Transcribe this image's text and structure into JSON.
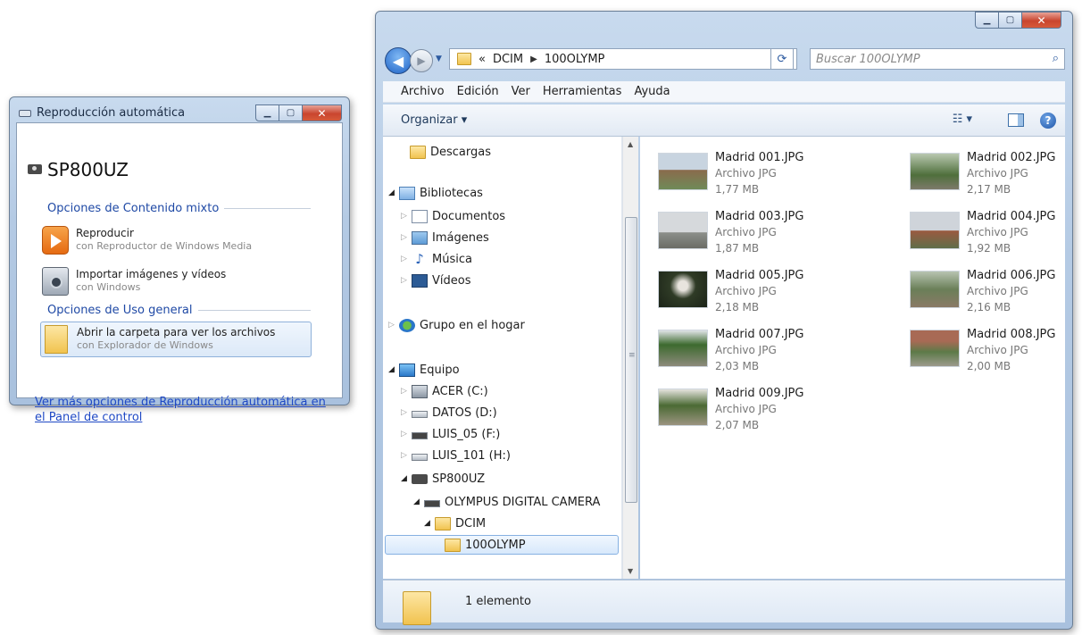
{
  "autoplay": {
    "title": "Reproducción automática",
    "device": "SP800UZ",
    "section_mixed": "Opciones de Contenido mixto",
    "play_title": "Reproducir",
    "play_sub": "con Reproductor de Windows Media",
    "import_title": "Importar imágenes y vídeos",
    "import_sub": "con Windows",
    "section_general": "Opciones de Uso general",
    "open_title": "Abrir la carpeta para ver los archivos",
    "open_sub": "con Explorador de Windows",
    "more_link": "Ver más opciones de Reproducción automática en el Panel de control"
  },
  "explorer": {
    "breadcrumb": [
      "«",
      "DCIM",
      "100OLYMP"
    ],
    "search_placeholder": "Buscar 100OLYMP",
    "menu": [
      "Archivo",
      "Edición",
      "Ver",
      "Herramientas",
      "Ayuda"
    ],
    "organize": "Organizar",
    "tree": [
      "Descargas",
      "Bibliotecas",
      "Documentos",
      "Imágenes",
      "Música",
      "Vídeos",
      "Grupo en el hogar",
      "Equipo",
      "ACER (C:)",
      "DATOS (D:)",
      "LUIS_05 (F:)",
      "LUIS_101 (H:)",
      "SP800UZ",
      "OLYMPUS DIGITAL CAMERA",
      "DCIM",
      "100OLYMP"
    ],
    "files": [
      {
        "name": "Madrid 001.JPG",
        "type": "Archivo JPG",
        "size": "1,77 MB"
      },
      {
        "name": "Madrid 002.JPG",
        "type": "Archivo JPG",
        "size": "2,17 MB"
      },
      {
        "name": "Madrid 003.JPG",
        "type": "Archivo JPG",
        "size": "1,87 MB"
      },
      {
        "name": "Madrid 004.JPG",
        "type": "Archivo JPG",
        "size": "1,92 MB"
      },
      {
        "name": "Madrid 005.JPG",
        "type": "Archivo JPG",
        "size": "2,18 MB"
      },
      {
        "name": "Madrid 006.JPG",
        "type": "Archivo JPG",
        "size": "2,16 MB"
      },
      {
        "name": "Madrid 007.JPG",
        "type": "Archivo JPG",
        "size": "2,03 MB"
      },
      {
        "name": "Madrid 008.JPG",
        "type": "Archivo JPG",
        "size": "2,00 MB"
      },
      {
        "name": "Madrid 009.JPG",
        "type": "Archivo JPG",
        "size": "2,07 MB"
      }
    ],
    "status": "1 elemento"
  },
  "colors": {
    "accent": "#1f49a5",
    "link": "#1f49c5",
    "selection": "#d7e8fb"
  }
}
